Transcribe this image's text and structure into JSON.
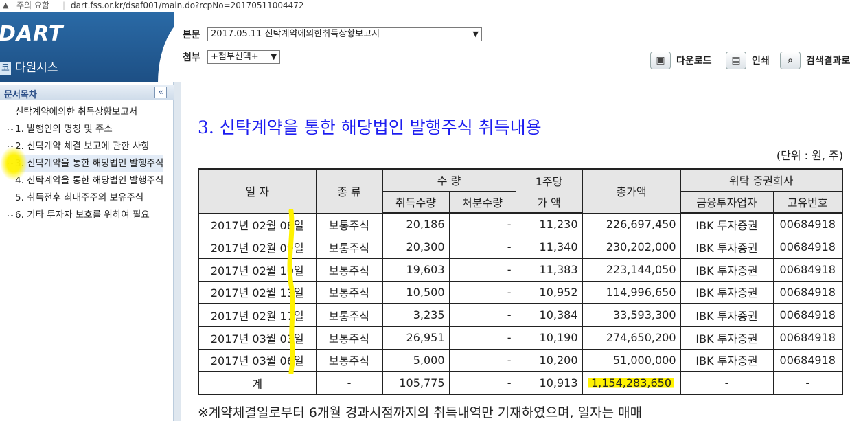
{
  "address_bar": {
    "security_label": "주의 요함",
    "url": "dart.fss.or.kr/dsaf001/main.do?rcpNo=20170511004472"
  },
  "brand": {
    "logo": "DART",
    "subtitle": "다원시스"
  },
  "header": {
    "main_label": "본문",
    "main_value": "2017.05.11  신탁계약에의한취득상황보고서",
    "attach_label": "첨부",
    "attach_value": "+첨부선택+",
    "download": "다운로드",
    "print": "인쇄",
    "search_results": "검색결과로"
  },
  "sidebar": {
    "title": "문서목차",
    "collapse": "«",
    "items": [
      "신탁계약에의한 취득상황보고서",
      "1. 발행인의 명칭 및 주소",
      "2. 신탁계약 체결 보고에 관한 사항",
      "3. 신탁계약을 통한 해당법인 발행주식",
      "4. 신탁계약을 통한 해당법인 발행주식",
      "5. 취득전후 최대주주의 보유주식",
      "6. 기타 투자자 보호를 위하여 필요"
    ],
    "selected_index": 3
  },
  "content": {
    "title": "3. 신탁계약을 통한 해당법인 발행주식 취득내용",
    "unit": "(단위 : 원, 주)",
    "headers": {
      "date": "일  자",
      "type": "종  류",
      "qty": "수  량",
      "acquired": "취득수량",
      "disposed": "처분수량",
      "price": "1주당",
      "price2": "가  액",
      "total": "총가액",
      "broker": "위탁 증권회사",
      "broker_name": "금융투자업자",
      "broker_id": "고유번호"
    },
    "rows": [
      {
        "date": "2017년 02월 08일",
        "type": "보통주식",
        "acq": "20,186",
        "disp": "-",
        "price": "11,230",
        "total": "226,697,450",
        "broker": "IBK 투자증권",
        "id": "00684918"
      },
      {
        "date": "2017년 02월 09일",
        "type": "보통주식",
        "acq": "20,300",
        "disp": "-",
        "price": "11,340",
        "total": "230,202,000",
        "broker": "IBK 투자증권",
        "id": "00684918"
      },
      {
        "date": "2017년 02월 10일",
        "type": "보통주식",
        "acq": "19,603",
        "disp": "-",
        "price": "11,383",
        "total": "223,144,050",
        "broker": "IBK 투자증권",
        "id": "00684918"
      },
      {
        "date": "2017년 02월 13일",
        "type": "보통주식",
        "acq": "10,500",
        "disp": "-",
        "price": "10,952",
        "total": "114,996,650",
        "broker": "IBK 투자증권",
        "id": "00684918"
      },
      {
        "date": "2017년 02월 17일",
        "type": "보통주식",
        "acq": "3,235",
        "disp": "-",
        "price": "10,384",
        "total": "33,593,300",
        "broker": "IBK 투자증권",
        "id": "00684918"
      },
      {
        "date": "2017년 03월 03일",
        "type": "보통주식",
        "acq": "26,951",
        "disp": "-",
        "price": "10,190",
        "total": "274,650,200",
        "broker": "IBK 투자증권",
        "id": "00684918"
      },
      {
        "date": "2017년 03월 06일",
        "type": "보통주식",
        "acq": "5,000",
        "disp": "-",
        "price": "10,200",
        "total": "51,000,000",
        "broker": "IBK 투자증권",
        "id": "00684918"
      }
    ],
    "total_row": {
      "date": "계",
      "type": "-",
      "acq": "105,775",
      "disp": "-",
      "price": "10,913",
      "total": "1,154,283,650",
      "broker": "-",
      "id": "-"
    },
    "note": "※계약체결일로부터 6개월 경과시점까지의 취득내역만 기재하였으며, 일자는 매매"
  },
  "colors": {
    "brand_blue": "#1d4f84",
    "title_blue": "#1d1df0",
    "highlight_yellow": "#fff200"
  }
}
